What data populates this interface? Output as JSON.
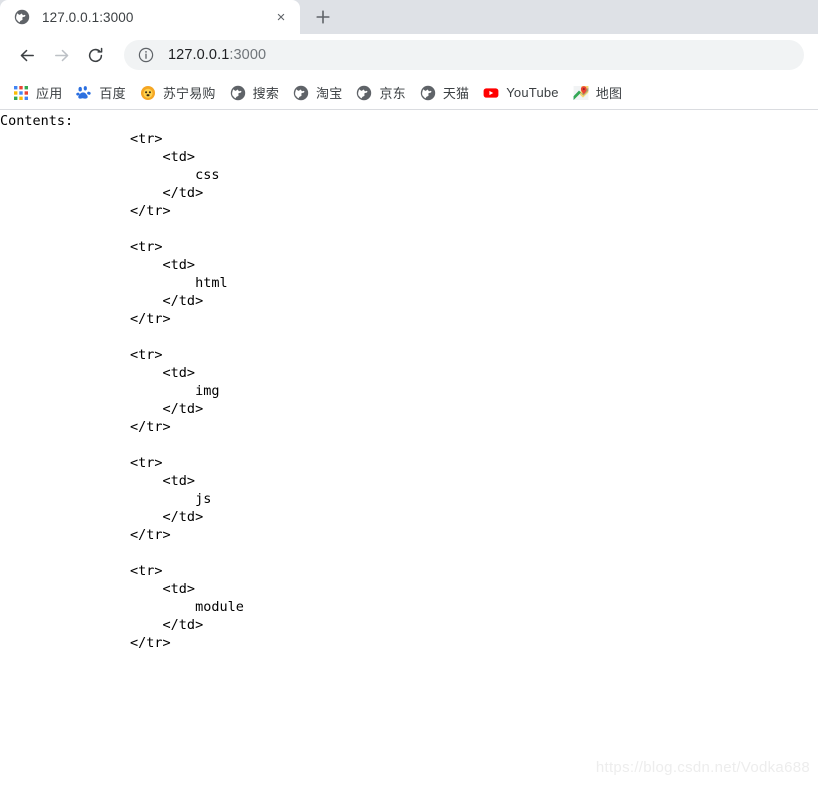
{
  "browser": {
    "tab": {
      "title": "127.0.0.1:3000",
      "favicon": "globe-icon",
      "close_label": "×"
    },
    "new_tab_label": "+",
    "nav": {
      "back": "back-arrow-icon",
      "forward": "forward-arrow-icon",
      "reload": "reload-icon"
    },
    "omnibox": {
      "info_icon": "info-circle-icon",
      "host": "127.0.0.1",
      "port": ":3000",
      "full_url": "127.0.0.1:3000"
    },
    "bookmarks": [
      {
        "label": "应用",
        "icon": "apps-grid-icon"
      },
      {
        "label": "百度",
        "icon": "baidu-paw-icon"
      },
      {
        "label": "苏宁易购",
        "icon": "suning-lion-icon"
      },
      {
        "label": "搜索",
        "icon": "globe-icon"
      },
      {
        "label": "淘宝",
        "icon": "globe-icon"
      },
      {
        "label": "京东",
        "icon": "globe-icon"
      },
      {
        "label": "天猫",
        "icon": "globe-icon"
      },
      {
        "label": "YouTube",
        "icon": "youtube-icon"
      },
      {
        "label": "地图",
        "icon": "google-maps-icon"
      }
    ]
  },
  "page": {
    "heading": "Contents:",
    "entries": [
      "css",
      "html",
      "img",
      "js",
      "module"
    ],
    "body_text": "Contents:\n                <tr>\n                    <td>\n                        css\n                    </td>\n                </tr>\n\n                <tr>\n                    <td>\n                        html\n                    </td>\n                </tr>\n\n                <tr>\n                    <td>\n                        img\n                    </td>\n                </tr>\n\n                <tr>\n                    <td>\n                        js\n                    </td>\n                </tr>\n\n                <tr>\n                    <td>\n                        module\n                    </td>\n                </tr>",
    "watermark": "https://blog.csdn.net/Vodka688"
  }
}
